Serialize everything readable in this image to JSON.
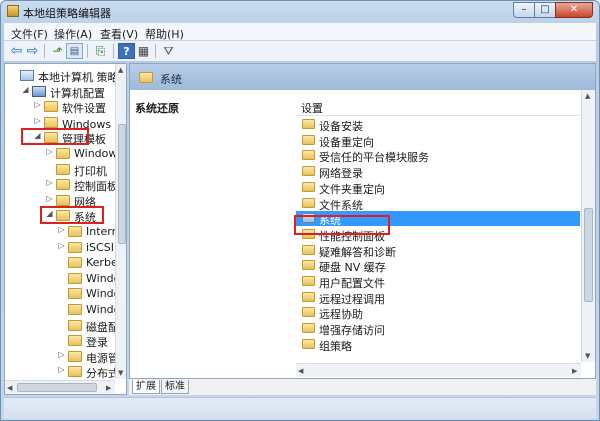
{
  "window": {
    "title": "本地组策略编辑器"
  },
  "menu": [
    "文件(F)",
    "操作(A)",
    "查看(V)",
    "帮助(H)"
  ],
  "tree": {
    "rows": [
      {
        "label": "本地计算机 策略",
        "icon": "policy-icon",
        "expander": "",
        "level": 0
      },
      {
        "label": "计算机配置",
        "icon": "computer-icon",
        "expander": "◢",
        "level": 1
      },
      {
        "label": "软件设置",
        "icon": "folder-icon",
        "expander": "▷",
        "level": 2
      },
      {
        "label": "Windows 设",
        "icon": "folder-icon",
        "expander": "▷",
        "level": 2
      },
      {
        "label": "管理模板",
        "icon": "folder-icon",
        "expander": "◢",
        "level": 2
      },
      {
        "label": "Windows",
        "icon": "folder-icon",
        "expander": "▷",
        "level": 3
      },
      {
        "label": "打印机",
        "icon": "folder-icon",
        "expander": "",
        "level": 3
      },
      {
        "label": "控制面板",
        "icon": "folder-icon",
        "expander": "▷",
        "level": 3
      },
      {
        "label": "网络",
        "icon": "folder-icon",
        "expander": "▷",
        "level": 3
      },
      {
        "label": "系统",
        "icon": "folder-icon",
        "expander": "◢",
        "level": 3
      },
      {
        "label": "Intern",
        "icon": "folder-icon",
        "expander": "▷",
        "level": 4
      },
      {
        "label": "iSCSI",
        "icon": "folder-icon",
        "expander": "▷",
        "level": 4
      },
      {
        "label": "Kerbe",
        "icon": "folder-icon",
        "expander": "",
        "level": 4
      },
      {
        "label": "Windo",
        "icon": "folder-icon",
        "expander": "",
        "level": 4
      },
      {
        "label": "Windo",
        "icon": "folder-icon",
        "expander": "",
        "level": 4
      },
      {
        "label": "Windo",
        "icon": "folder-icon",
        "expander": "",
        "level": 4
      },
      {
        "label": "磁盘配",
        "icon": "folder-icon",
        "expander": "",
        "level": 4
      },
      {
        "label": "登录",
        "icon": "folder-icon",
        "expander": "",
        "level": 4
      },
      {
        "label": "电源管",
        "icon": "folder-icon",
        "expander": "▷",
        "level": 4
      },
      {
        "label": "分布式",
        "icon": "folder-icon",
        "expander": "▷",
        "level": 4
      }
    ]
  },
  "right": {
    "header_title": "系统",
    "description_title": "系统还原",
    "column_header": "设置",
    "items": [
      {
        "label": "设备安装",
        "selected": false
      },
      {
        "label": "设备重定向",
        "selected": false
      },
      {
        "label": "受信任的平台模块服务",
        "selected": false
      },
      {
        "label": "网络登录",
        "selected": false
      },
      {
        "label": "文件夹重定向",
        "selected": false
      },
      {
        "label": "文件系统",
        "selected": false
      },
      {
        "label": "系统",
        "selected": true
      },
      {
        "label": "性能控制面板",
        "selected": false
      },
      {
        "label": "疑难解答和诊断",
        "selected": false
      },
      {
        "label": "硬盘 NV 缓存",
        "selected": false
      },
      {
        "label": "用户配置文件",
        "selected": false
      },
      {
        "label": "远程过程调用",
        "selected": false
      },
      {
        "label": "远程协助",
        "selected": false
      },
      {
        "label": "增强存储访问",
        "selected": false
      },
      {
        "label": "组策略",
        "selected": false
      }
    ]
  },
  "tabs": [
    "扩展",
    "标准"
  ],
  "colors": {
    "selection": "#3399ff",
    "annotation": "#e02020",
    "header": "#9fb9db"
  }
}
